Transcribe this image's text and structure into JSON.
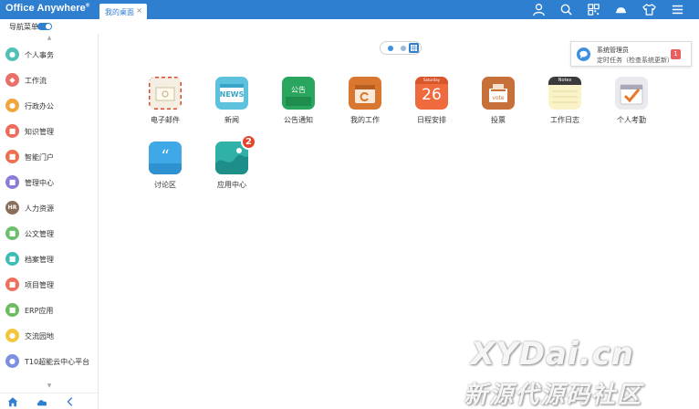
{
  "header": {
    "brand": "Office Anywhere",
    "brand_mark": "®",
    "active_tab": "我的桌面",
    "tab_close": "×"
  },
  "toolbar_icons": [
    "user-icon",
    "search-icon",
    "grid-icon",
    "cap-icon",
    "shirt-icon",
    "menu-icon"
  ],
  "nav_toggle": {
    "label": "导航菜单",
    "enabled": true
  },
  "sidebar": {
    "scroll_up": "▲",
    "scroll_down": "▼",
    "items": [
      {
        "label": "个人事务",
        "icon": "person-icon",
        "glyph": "●",
        "color": "#4fc1b6"
      },
      {
        "label": "工作流",
        "icon": "workflow-icon",
        "glyph": "◆",
        "color": "#e9706a"
      },
      {
        "label": "行政办公",
        "icon": "admin-icon",
        "glyph": "●",
        "color": "#f2a53a"
      },
      {
        "label": "知识管理",
        "icon": "knowledge-icon",
        "glyph": "■",
        "color": "#ee6a5a"
      },
      {
        "label": "智能门户",
        "icon": "portal-icon",
        "glyph": "■",
        "color": "#ec6f4f"
      },
      {
        "label": "管理中心",
        "icon": "manage-icon",
        "glyph": "■",
        "color": "#8c7ad8"
      },
      {
        "label": "人力资源",
        "icon": "hr-icon",
        "glyph": "HR",
        "color": "#8a6e5c"
      },
      {
        "label": "公文管理",
        "icon": "document-icon",
        "glyph": "■",
        "color": "#6cc06c"
      },
      {
        "label": "档案管理",
        "icon": "archive-icon",
        "glyph": "■",
        "color": "#3dbcb5"
      },
      {
        "label": "项目管理",
        "icon": "project-icon",
        "glyph": "■",
        "color": "#ef6e5c"
      },
      {
        "label": "ERP应用",
        "icon": "erp-icon",
        "glyph": "■",
        "color": "#69bd5d"
      },
      {
        "label": "交流园地",
        "icon": "chat-icon",
        "glyph": "●",
        "color": "#f4c63a"
      },
      {
        "label": "T10超能云中心平台",
        "icon": "cloud-icon",
        "glyph": "●",
        "color": "#7d8fe0"
      }
    ]
  },
  "bottombar_icons": [
    "home-icon",
    "cloud-icon",
    "chevron-left-icon"
  ],
  "pager": {
    "pages": 2,
    "active": 1
  },
  "notification": {
    "title": "系统管理员",
    "text": "定时任务（检查系统更新）",
    "count": "1"
  },
  "apps": [
    {
      "label": "电子邮件",
      "icon": "email-icon",
      "badge": ""
    },
    {
      "label": "新闻",
      "icon": "news-icon",
      "badge": "",
      "icon_text": "NEWS"
    },
    {
      "label": "公告通知",
      "icon": "notice-icon",
      "badge": "",
      "icon_text": "公告"
    },
    {
      "label": "我的工作",
      "icon": "work-icon",
      "badge": ""
    },
    {
      "label": "日程安排",
      "icon": "calendar-icon",
      "badge": "",
      "icon_text": "26",
      "icon_sub": "Saturday"
    },
    {
      "label": "投票",
      "icon": "vote-icon",
      "badge": "",
      "icon_text": "vote"
    },
    {
      "label": "工作日志",
      "icon": "notes-icon",
      "badge": "",
      "icon_text": "Notes"
    },
    {
      "label": "个人考勤",
      "icon": "attendance-icon",
      "badge": ""
    },
    {
      "label": "讨论区",
      "icon": "discussion-icon",
      "badge": ""
    },
    {
      "label": "应用中心",
      "icon": "app-center-icon",
      "badge": "2"
    }
  ],
  "watermark": {
    "line1": "XYDai.cn",
    "line2": "新源代源码社区"
  },
  "colors": {
    "primary": "#2f7fd1",
    "badge_red": "#e6432c"
  }
}
